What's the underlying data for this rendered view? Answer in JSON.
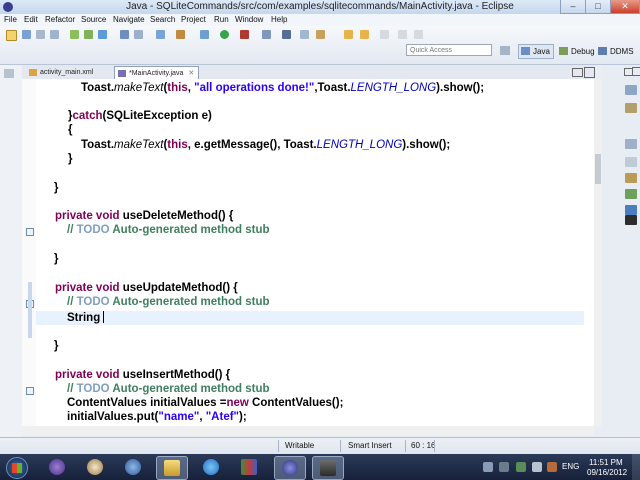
{
  "window": {
    "title": "Java - SQLiteCommands/src/com/examples/sqlitecommands/MainActivity.java - Eclipse",
    "minimize_glyph": "–",
    "maximize_glyph": "□",
    "close_glyph": "✕"
  },
  "menu": [
    "File",
    "Edit",
    "Refactor",
    "Source",
    "Navigate",
    "Search",
    "Project",
    "Run",
    "Window",
    "Help"
  ],
  "toolbar": {
    "quick_access_placeholder": "Quick Access",
    "perspectives": [
      {
        "label": "Java",
        "active": true,
        "icon": "java-perspective-icon"
      },
      {
        "label": "Debug",
        "active": false,
        "icon": "debug-perspective-icon"
      },
      {
        "label": "DDMS",
        "active": false,
        "icon": "ddms-perspective-icon"
      }
    ]
  },
  "editor_tabs": [
    {
      "label": "activity_main.xml",
      "active": false,
      "icon": "xml-file-icon"
    },
    {
      "label": "*MainActivity.java",
      "active": true,
      "icon": "java-file-icon"
    }
  ],
  "tab_close_glyph": "✕",
  "code": {
    "l1_a": "Toast.",
    "l1_b": "makeText",
    "l1_c": "(",
    "l1_d": "this",
    "l1_e": ", ",
    "l1_f": "\"all operations done!\"",
    "l1_g": ",Toast.",
    "l1_h": "LENGTH_LONG",
    "l1_i": ").show();",
    "l2_a": "}",
    "l2_b": "catch",
    "l2_c": "(SQLiteException e)",
    "l3": "{",
    "l4_a": "Toast.",
    "l4_b": "makeText",
    "l4_c": "(",
    "l4_d": "this",
    "l4_e": ", e.getMessage(), Toast.",
    "l4_f": "LENGTH_LONG",
    "l4_g": ").show();",
    "l5": "}",
    "l6": "}",
    "l7_a": "private",
    "l7_b": "void",
    "l7_c": "useDeleteMethod() {",
    "l8_a": "// ",
    "l8_b": "TODO",
    "l8_c": " Auto-generated method stub",
    "l9": "}",
    "l10_a": "private",
    "l10_b": "void",
    "l10_c": "useUpdateMethod() {",
    "l11_a": "// ",
    "l11_b": "TODO",
    "l11_c": " Auto-generated method stub",
    "l12": "String ",
    "l13": "}",
    "l14_a": "private",
    "l14_b": "void",
    "l14_c": "useInsertMethod() {",
    "l15_a": "// ",
    "l15_b": "TODO",
    "l15_c": " Auto-generated method stub",
    "l16_a": "ContentValues initialValues =",
    "l16_b": "new",
    "l16_c": " ContentValues();",
    "l17_a": "initialValues.put(",
    "l17_b": "\"name\"",
    "l17_c": ", ",
    "l17_d": "\"Atef\"",
    "l17_e": ");"
  },
  "status": {
    "mode": "Writable",
    "insert_mode": "Smart Insert",
    "position": "60 : 16"
  },
  "taskbar": {
    "apps": [
      "windows-media-center-icon",
      "java-cup-icon",
      "media-player-icon",
      "file-explorer-icon",
      "internet-explorer-icon",
      "books-icon",
      "eclipse-icon",
      "screen-recorder-icon"
    ],
    "language": "ENG",
    "time": "11:51 PM",
    "date": "09/16/2012"
  },
  "colors": {
    "keyword": "#7f0055",
    "string": "#2a00ff",
    "comment": "#3f7f5f",
    "todo": "#7f9fbf",
    "constant": "#0000c0",
    "current_line": "#e8f2fe"
  }
}
